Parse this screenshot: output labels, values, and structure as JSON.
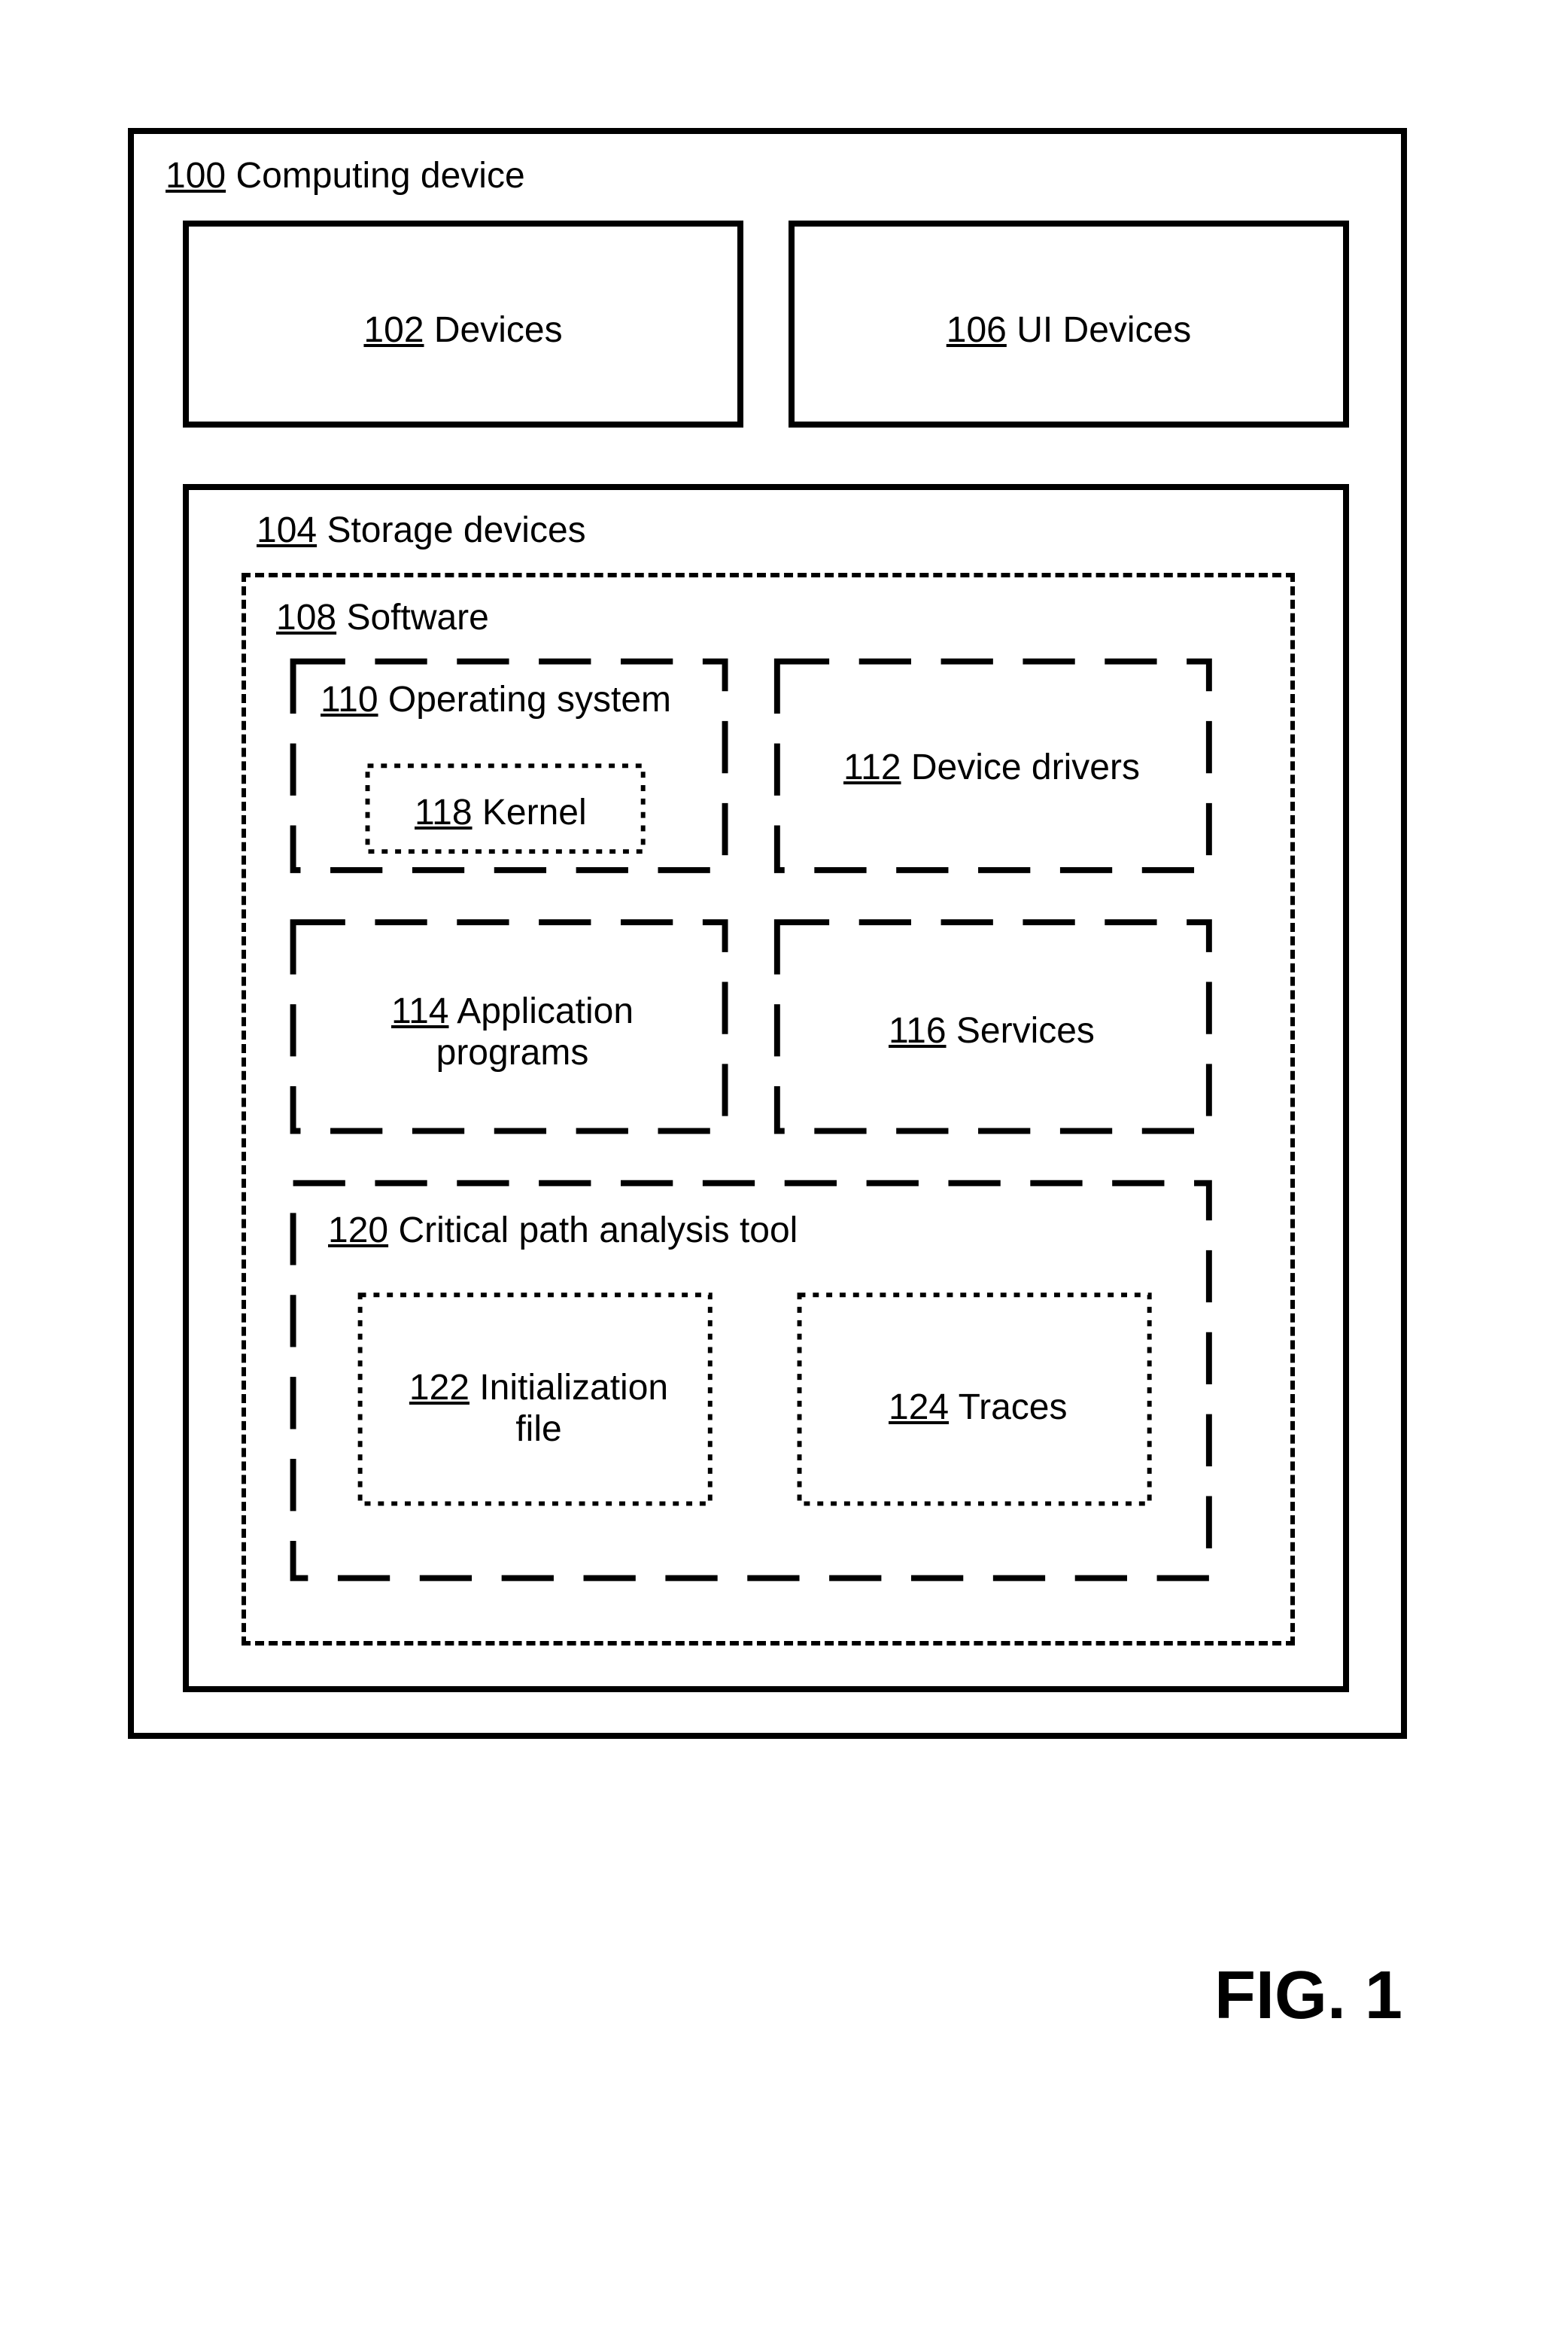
{
  "figure_caption": "FIG. 1",
  "b100": {
    "num": "100",
    "text": "Computing device"
  },
  "b102": {
    "num": "102",
    "text": "Devices"
  },
  "b106": {
    "num": "106",
    "text": "UI Devices"
  },
  "b104": {
    "num": "104",
    "text": "Storage devices"
  },
  "b108": {
    "num": "108",
    "text": "Software"
  },
  "b110": {
    "num": "110",
    "text": "Operating system"
  },
  "b118": {
    "num": "118",
    "text": "Kernel"
  },
  "b112": {
    "num": "112",
    "text": "Device drivers"
  },
  "b114": {
    "num": "114",
    "text": "Application programs"
  },
  "b116": {
    "num": "116",
    "text": "Services"
  },
  "b120": {
    "num": "120",
    "text": "Critical path analysis tool"
  },
  "b122": {
    "num": "122",
    "text": "Initialization file"
  },
  "b124": {
    "num": "124",
    "text": "Traces"
  }
}
